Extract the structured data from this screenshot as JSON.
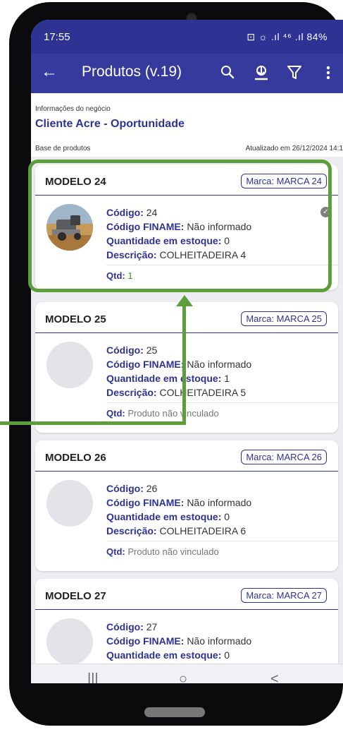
{
  "status_bar": {
    "time": "17:55",
    "indicators": "⊡ ☼ .ıl ⁴⁶ .ıl 84%"
  },
  "app_bar": {
    "title": "Produtos (v.19)",
    "back_icon": "arrow-left-icon",
    "actions": [
      "search-icon",
      "download-icon",
      "filter-icon",
      "more-vert-icon"
    ]
  },
  "info": {
    "section_label": "Informações do negócio",
    "client": "Cliente Acre - Oportunidade",
    "base_label": "Base de produtos",
    "updated": "Atualizado em 26/12/2024 14:1"
  },
  "labels": {
    "code": "Código:",
    "finame": "Código FINAME:",
    "stock": "Quantidade em estoque:",
    "description": "Descrição:",
    "qty": "Qtd:"
  },
  "products": [
    {
      "model": "MODELO 24",
      "brand": "Marca: MARCA 24",
      "code": "24",
      "finame": "Não informado",
      "stock": "0",
      "description": "COLHEITADEIRA 4",
      "qty": "1",
      "selected": true
    },
    {
      "model": "MODELO 25",
      "brand": "Marca: MARCA 25",
      "code": "25",
      "finame": "Não informado",
      "stock": "1",
      "description": "COLHEITADEIRA 5",
      "qty": "Produto não vinculado",
      "selected": false
    },
    {
      "model": "MODELO 26",
      "brand": "Marca: MARCA 26",
      "code": "26",
      "finame": "Não informado",
      "stock": "0",
      "description": "COLHEITADEIRA 6",
      "qty": "Produto não vinculado",
      "selected": false
    },
    {
      "model": "MODELO 27",
      "brand": "Marca: MARCA 27",
      "code": "27",
      "finame": "Não informado",
      "stock": "0",
      "description": "",
      "qty": "",
      "selected": false
    }
  ],
  "nav": {
    "recent": "|||",
    "home": "○",
    "back": "<"
  },
  "colors": {
    "primary": "#2e3292",
    "appbar": "#353a9c",
    "highlight": "#5e9d3b",
    "qty_green": "#2f9b2f"
  }
}
